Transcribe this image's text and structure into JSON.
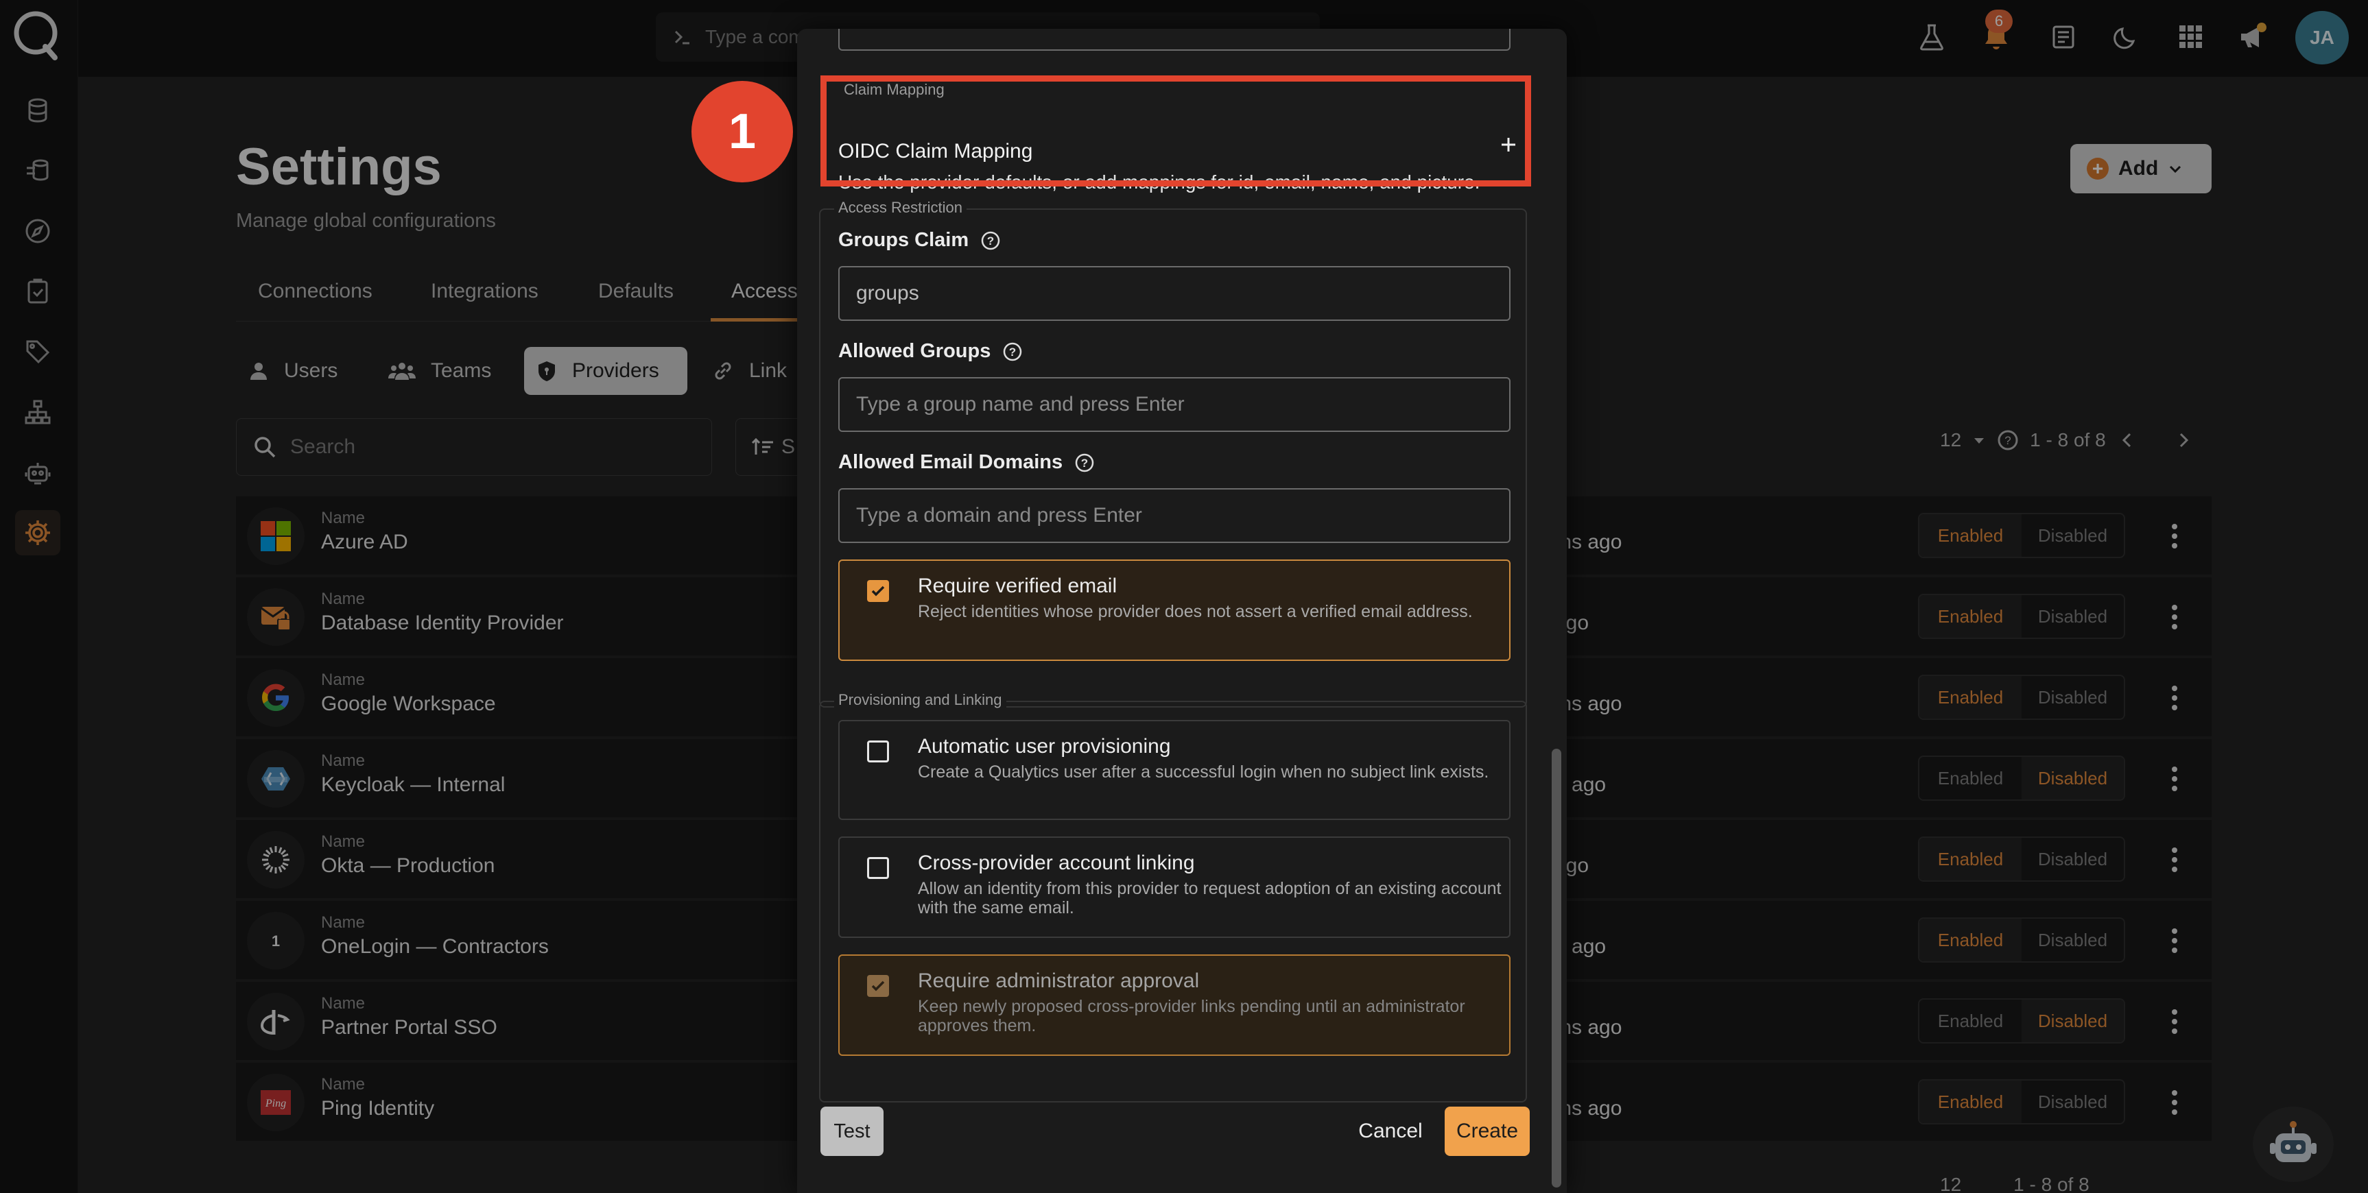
{
  "command_bar": {
    "placeholder": "Type a comm"
  },
  "notifications": {
    "count": "6"
  },
  "user": {
    "initials": "JA"
  },
  "page": {
    "title": "Settings",
    "subtitle": "Manage global configurations"
  },
  "tabs": [
    "Connections",
    "Integrations",
    "Defaults",
    "Access"
  ],
  "active_tab": "Access",
  "subtabs": [
    "Users",
    "Teams",
    "Providers",
    "Link"
  ],
  "active_subtab": "Providers",
  "search": {
    "placeholder": "Search"
  },
  "sort": {
    "label": "S"
  },
  "add_button": {
    "label": "Add"
  },
  "pager": {
    "page_size": "12",
    "range": "1 - 8 of 8"
  },
  "table": {
    "name_label": "Name",
    "updated_label": "d",
    "toggle_enabled": "Enabled",
    "toggle_disabled": "Disabled",
    "rows": [
      {
        "name": "Azure AD",
        "updated": "ths ago",
        "state": "Enabled",
        "logo": "microsoft-logo-icon"
      },
      {
        "name": "Database Identity Provider",
        "updated": "ago",
        "state": "Enabled",
        "logo": "database-lock-icon"
      },
      {
        "name": "Google Workspace",
        "updated": "ths ago",
        "state": "Enabled",
        "logo": "google-logo-icon"
      },
      {
        "name": "Keycloak — Internal",
        "updated": "h ago",
        "state": "Disabled",
        "logo": "keycloak-logo-icon"
      },
      {
        "name": "Okta — Production",
        "updated": "ago",
        "state": "Enabled",
        "logo": "okta-logo-icon"
      },
      {
        "name": "OneLogin — Contractors",
        "updated": "h ago",
        "state": "Enabled",
        "logo": "onelogin-logo-icon"
      },
      {
        "name": "Partner Portal SSO",
        "updated": "ths ago",
        "state": "Disabled",
        "logo": "openid-logo-icon"
      },
      {
        "name": "Ping Identity",
        "updated": "ths ago",
        "state": "Enabled",
        "logo": "ping-logo-icon"
      }
    ]
  },
  "modal": {
    "claim_mapping": {
      "legend": "Claim Mapping",
      "title": "OIDC Claim Mapping",
      "description": "Use the provider defaults, or add mappings for id, email, name, and picture."
    },
    "access_restriction": {
      "legend": "Access Restriction",
      "groups_claim_label": "Groups Claim",
      "groups_claim_value": "groups",
      "allowed_groups_label": "Allowed Groups",
      "allowed_groups_placeholder": "Type a group name and press Enter",
      "allowed_domains_label": "Allowed Email Domains",
      "allowed_domains_placeholder": "Type a domain and press Enter",
      "require_verified": {
        "title": "Require verified email",
        "description": "Reject identities whose provider does not assert a verified email address.",
        "checked": true
      }
    },
    "provisioning": {
      "legend": "Provisioning and Linking",
      "auto_provision": {
        "title": "Automatic user provisioning",
        "description": "Create a Qualytics user after a successful login when no subject link exists.",
        "checked": false
      },
      "cross_link": {
        "title": "Cross-provider account linking",
        "description": "Allow an identity from this provider to request adoption of an existing account with the same email.",
        "checked": false
      },
      "admin_approval": {
        "title": "Require administrator approval",
        "description": "Keep newly proposed cross-provider links pending until an administrator approves them.",
        "checked": true,
        "disabled": true
      }
    },
    "buttons": {
      "test": "Test",
      "cancel": "Cancel",
      "create": "Create"
    }
  },
  "annotation": {
    "step_number": "1"
  },
  "colors": {
    "accent": "#e38a3c",
    "highlight": "#e2442e",
    "create_button": "#f1a24c"
  }
}
